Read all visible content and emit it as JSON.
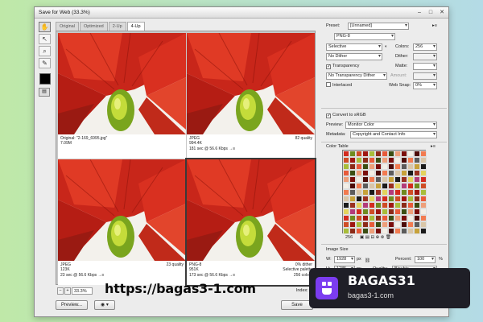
{
  "window": {
    "title": "Save for Web (33.3%)"
  },
  "tabs": [
    "Original",
    "Optimized",
    "2-Up",
    "4-Up"
  ],
  "cells": [
    {
      "left_lines": [
        "Original: \"2-169_6995.jpg\"",
        "7.09M"
      ],
      "right_lines": [
        ""
      ]
    },
    {
      "left_lines": [
        "JPEG",
        "994.4K",
        "181 sec @ 56.6 Kbps →≡"
      ],
      "right_lines": [
        "82 quality"
      ]
    },
    {
      "left_lines": [
        "JPEG",
        "123K",
        "23 sec @ 56.6 Kbps →≡"
      ],
      "right_lines": [
        "23 quality"
      ]
    },
    {
      "left_lines": [
        "PNG-8",
        "951K",
        "173 sec @ 56.6 Kbps →≡"
      ],
      "right_lines": [
        "0% dither",
        "Selective palette",
        "256 colors"
      ]
    }
  ],
  "bottombar": {
    "zoom": "33.3%",
    "minus": "−",
    "plus": "+",
    "right_text": "Index: --"
  },
  "buttons": {
    "preview": "Preview...",
    "save": "Save"
  },
  "panel": {
    "preset_label": "Preset:",
    "preset_value": "[Unnamed]",
    "format_value": "PNG-8",
    "reduction_value": "Selective",
    "colors_label": "Colors:",
    "colors_value": "256",
    "dither_value": "No Dither",
    "dither_label": "Dither:",
    "transparency_label": "Transparency",
    "matte_label": "Matte:",
    "transp_dither_value": "No Transparency Dither",
    "amount_label": "Amount:",
    "interlaced_label": "Interlaced",
    "websnap_label": "Web Snap:",
    "websnap_value": "0%",
    "convert_label": "Convert to sRGB",
    "preview_label": "Preview:",
    "preview_value": "Monitor Color",
    "metadata_label": "Metadata:",
    "metadata_value": "Copyright and Contact Info",
    "colortable_label": "Color Table",
    "colortable_count": "256",
    "imagesize_label": "Image Size",
    "w_label": "W:",
    "w_value": "1928",
    "h_label": "H:",
    "h_value": "1285",
    "px": "px",
    "percent_label": "Percent:",
    "percent_value": "100",
    "percent_unit": "%",
    "quality_label": "Quality:",
    "quality_value": "Bicubic"
  },
  "colors": {
    "palette": [
      "#d32b1f",
      "#a01611",
      "#e85a3a",
      "#7a0d0b",
      "#f27b50",
      "#c7a23a",
      "#e3d35c",
      "#6f8b1f",
      "#a8bd3a",
      "#3b4d12",
      "#f3efe6",
      "#5b5b5b",
      "#1a1a1a",
      "#b33b7a",
      "#cf4d26",
      "#8c2a18",
      "#ee9f7a",
      "#4c0a07",
      "#d9c6a8",
      "#9a3020"
    ]
  },
  "watermark": {
    "url": "https://bagas3-1.com",
    "brand": "BAGAS31",
    "brand_url": "bagas3-1.com"
  }
}
